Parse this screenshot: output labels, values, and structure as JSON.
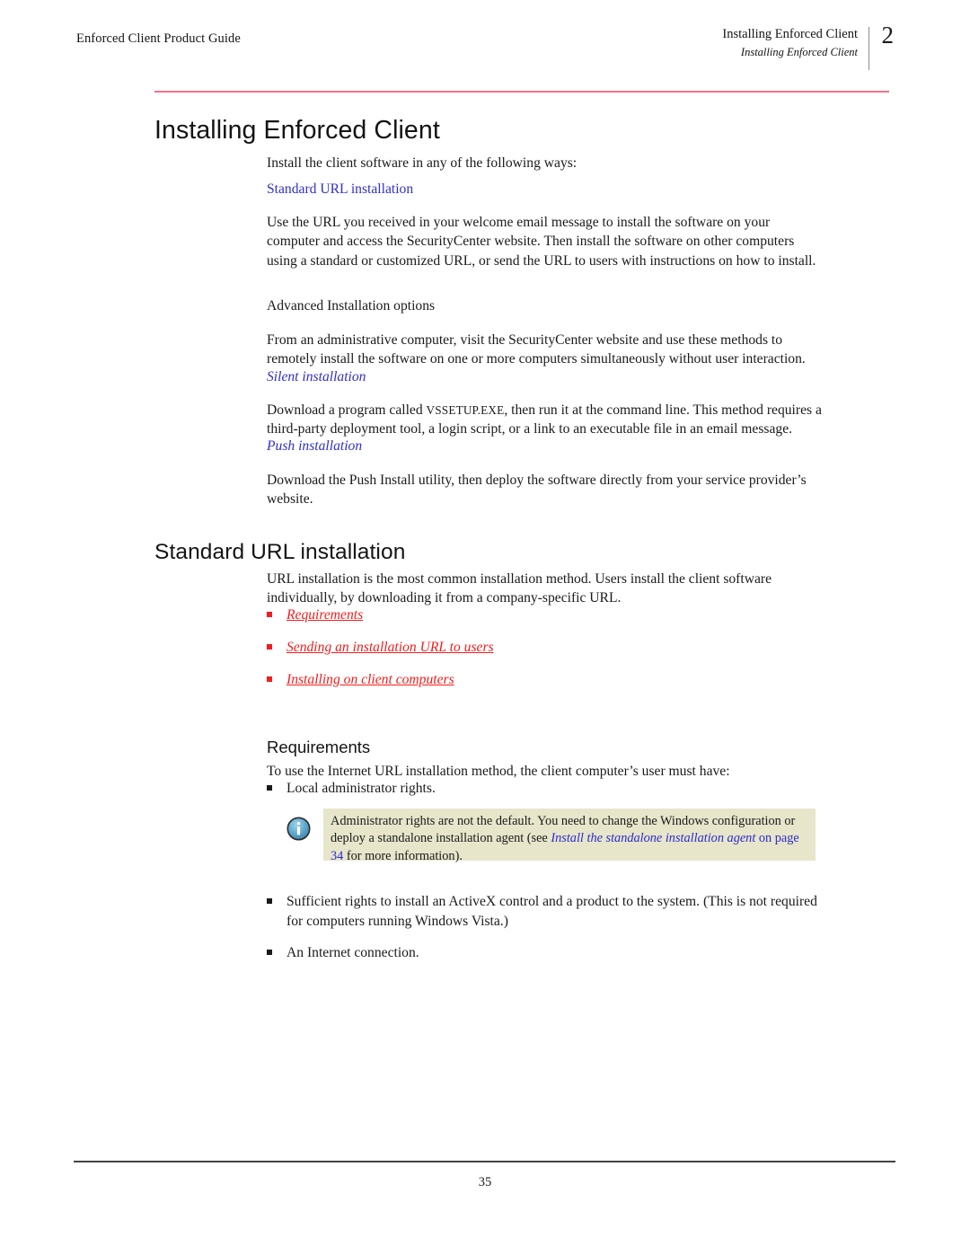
{
  "header": {
    "left_title": "Enforced Client Product Guide",
    "chapter_title": "Installing Enforced Client",
    "section_title": "Installing Enforced Client",
    "chapter_number": "2"
  },
  "chapter": {
    "title": "Installing Enforced Client",
    "intro": "Install the client software in any of the following ways:",
    "methods": [
      {
        "heading": "Standard URL installation",
        "heading_style": "blue",
        "body": "Use the URL you received in your welcome email message to install the software on your computer and access the SecurityCenter website. Then install the software on other computers using a standard or customized URL, or send the URL to users with instructions on how to install."
      },
      {
        "heading": "Advanced Installation options",
        "heading_style": "plain",
        "body": "From an administrative computer, visit the SecurityCenter website and use these methods to remotely install the software on one or more computers simultaneously without user interaction."
      },
      {
        "heading": "Silent installation",
        "heading_style": "blue-italic",
        "body_before": "Download a program called ",
        "body_code": "VSSETUP.EXE",
        "body_after": ", then run it at the command line. This method requires a third-party deployment tool, a login script, or a link to an executable file in an email message."
      },
      {
        "heading": "Push installation",
        "heading_style": "blue-italic",
        "body": "Download the Push Install utility, then deploy the software directly from your service provider’s website."
      }
    ]
  },
  "standard_url_section": {
    "title": "Standard URL installation",
    "intro": "URL installation is the most common installation method. Users install the client software individually, by downloading it from a company-specific URL.",
    "links": [
      "Requirements",
      "Sending an installation URL to users",
      "Installing on client computers"
    ]
  },
  "requirements_section": {
    "title": "Requirements",
    "intro": "To use the Internet URL installation method, the client computer’s user must have:",
    "bullets_before_note": [
      "Local administrator rights."
    ],
    "note": {
      "icon": "info-icon",
      "text_before_link": "Administrator rights are not the default. You need to change the Windows configuration or deploy a standalone installation agent (see ",
      "link_text": "Install the standalone installation agent",
      "text_after_link": " on page 34",
      "text_tail": " for more information).",
      "background_color": "#e7e6cb",
      "link_color": "#2a2acc"
    },
    "bullets_after_note": [
      "Sufficient rights to install an ActiveX control and a product to the system. (This is not required for computers running Windows Vista.)",
      "An Internet connection."
    ]
  },
  "footer": {
    "page_number": "35"
  },
  "colors": {
    "heading_rule": "#f2718a",
    "blue_heading": "#3030cc",
    "red_link": "#f21d1d",
    "note_background": "#e7e6cb"
  }
}
